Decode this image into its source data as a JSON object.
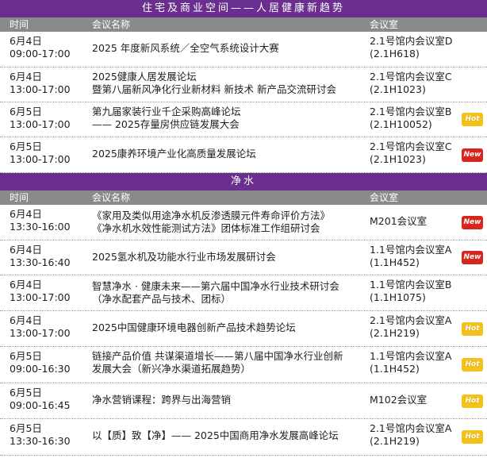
{
  "section1": {
    "title": "住宅及商业空间——人居健康新趋势",
    "headers": [
      "时间",
      "会议名称",
      "会议室"
    ],
    "rows": [
      {
        "date": "6月4日",
        "time": "09:00-17:00",
        "title": [
          "2025 年度新风系统／全空气系统设计大赛"
        ],
        "room": [
          "2.1号馆内会议室D",
          "(2.1H618)"
        ],
        "badge": ""
      },
      {
        "date": "6月4日",
        "time": "13:00-17:00",
        "title": [
          "2025健康人居发展论坛",
          "暨第八届新风净化行业新材料 新技术 新产品交流研讨会"
        ],
        "room": [
          "2.1号馆内会议室C",
          "(2.1H1023)"
        ],
        "badge": ""
      },
      {
        "date": "6月5日",
        "time": "13:00-17:00",
        "title": [
          "第九届家装行业千企采购高峰论坛",
          "—— 2025存量房供应链发展大会"
        ],
        "room": [
          "2.1号馆内会议室B",
          "(2.1H10052)"
        ],
        "badge": "Hot"
      },
      {
        "date": "6月5日",
        "time": "13:00-17:00",
        "title": [
          "2025康养环境产业化高质量发展论坛"
        ],
        "room": [
          "2.1号馆内会议室C",
          "(2.1H1023)"
        ],
        "badge": "New"
      }
    ]
  },
  "section2": {
    "title": "净水",
    "headers": [
      "时间",
      "会议名称",
      "会议室"
    ],
    "rows": [
      {
        "date": "6月4日",
        "time": "13:30-16:00",
        "title": [
          "《家用及类似用途净水机反渗透膜元件寿命评价方法》",
          "《净水机水效性能测试方法》团体标准工作组研讨会"
        ],
        "room": [
          "M201会议室"
        ],
        "badge": "New"
      },
      {
        "date": "6月4日",
        "time": "13:30-16:40",
        "title": [
          "2025氢水机及功能水行业市场发展研讨会"
        ],
        "room": [
          "1.1号馆内会议室A",
          "(1.1H452)"
        ],
        "badge": "New"
      },
      {
        "date": "6月4日",
        "time": "13:00-17:00",
        "title": [
          "智慧净水 · 健康未来——第六届中国净水行业技术研讨会",
          "（净水配套产品与技术、团标）"
        ],
        "room": [
          "1.1号馆内会议室B",
          "(1.1H1075)"
        ],
        "badge": ""
      },
      {
        "date": "6月4日",
        "time": "13:00-17:00",
        "title": [
          "2025中国健康环境电器创新产品技术趋势论坛"
        ],
        "room": [
          "2.1号馆内会议室A",
          "(2.1H219)"
        ],
        "badge": "Hot"
      },
      {
        "date": "6月5日",
        "time": "09:00-16:30",
        "title": [
          "链接产品价值 共谋渠道增长——第八届中国净水行业创新",
          "发展大会（新兴净水渠道拓展趋势）"
        ],
        "room": [
          "1.1号馆内会议室A",
          "(1.1H452)"
        ],
        "badge": "Hot"
      },
      {
        "date": "6月5日",
        "time": "09:00-16:45",
        "title": [
          "净水营销课程：跨界与出海营销"
        ],
        "room": [
          "M102会议室"
        ],
        "badge": "Hot"
      },
      {
        "date": "6月5日",
        "time": "13:30-16:30",
        "title": [
          "以【质】致【净】—— 2025中国商用净水发展高峰论坛"
        ],
        "room": [
          "2.1号馆内会议室A",
          "(2.1H219)"
        ],
        "badge": "Hot"
      }
    ]
  },
  "colors": {
    "section_bg": "#6a2f8e",
    "header_bg": "#8a8a8a",
    "hot": "#f2c21a",
    "new": "#d9261c"
  }
}
